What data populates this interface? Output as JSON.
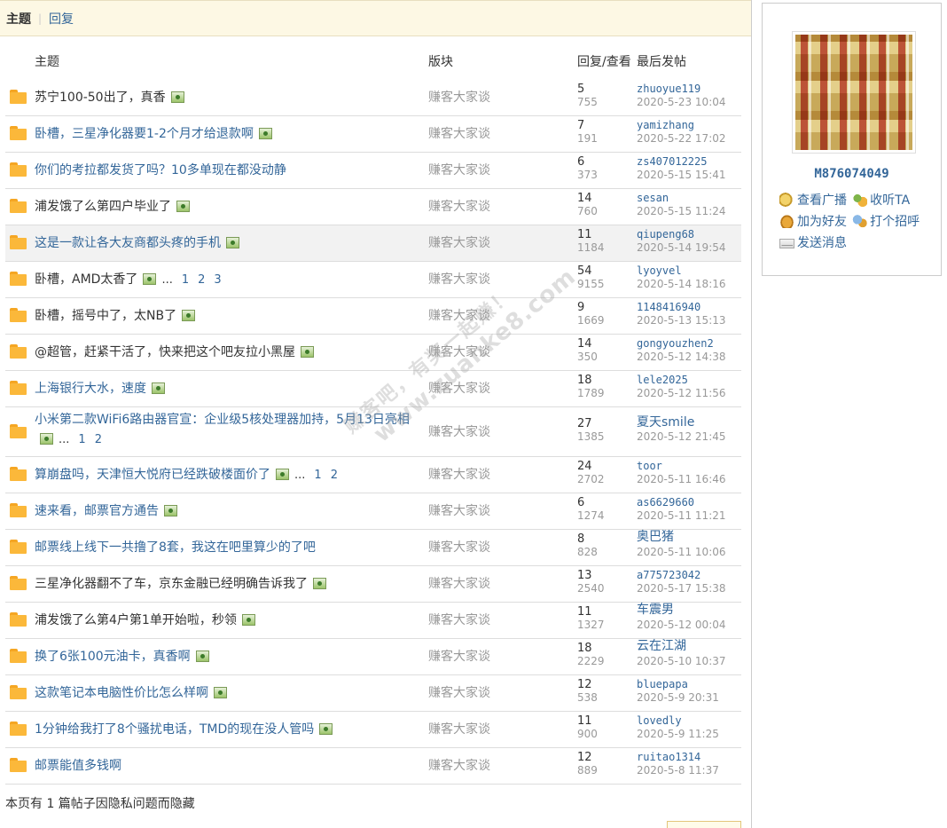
{
  "tabs": [
    {
      "label": "主题",
      "active": true
    },
    {
      "label": "回复",
      "active": false
    }
  ],
  "columns": {
    "topic": "主题",
    "forum": "版块",
    "replies_views": "回复/查看",
    "last_post": "最后发帖"
  },
  "threads": [
    {
      "title": "苏宁100-50出了，真香",
      "blue": false,
      "img": true,
      "pages": [],
      "forum": "赚客大家谈",
      "replies": "5",
      "views": "755",
      "author": "zhuoyue119",
      "date": "2020-5-23 10:04"
    },
    {
      "title": "卧槽，三星净化器要1-2个月才给退款啊",
      "blue": true,
      "img": true,
      "pages": [],
      "forum": "赚客大家谈",
      "replies": "7",
      "views": "191",
      "author": "yamizhang",
      "date": "2020-5-22 17:02"
    },
    {
      "title": "你们的考拉都发货了吗？10多单现在都没动静",
      "blue": true,
      "img": false,
      "pages": [],
      "forum": "赚客大家谈",
      "replies": "6",
      "views": "373",
      "author": "zs407012225",
      "date": "2020-5-15 15:41"
    },
    {
      "title": "浦发饿了么第四户毕业了",
      "blue": false,
      "img": true,
      "pages": [],
      "forum": "赚客大家谈",
      "replies": "14",
      "views": "760",
      "author": "sesan",
      "date": "2020-5-15 11:24"
    },
    {
      "title": "这是一款让各大友商都头疼的手机",
      "blue": true,
      "img": true,
      "pages": [],
      "forum": "赚客大家谈",
      "replies": "11",
      "views": "1184",
      "author": "qiupeng68",
      "date": "2020-5-14 19:54",
      "highlight": true
    },
    {
      "title": "卧槽，AMD太香了",
      "blue": false,
      "img": true,
      "ellipsis": "...",
      "pages": [
        "1",
        "2",
        "3"
      ],
      "forum": "赚客大家谈",
      "replies": "54",
      "views": "9155",
      "author": "lyoyvel",
      "date": "2020-5-14 18:16"
    },
    {
      "title": "卧槽，摇号中了，太NB了",
      "blue": false,
      "img": true,
      "pages": [],
      "forum": "赚客大家谈",
      "replies": "9",
      "views": "1669",
      "author": "1148416940",
      "date": "2020-5-13 15:13"
    },
    {
      "title": "@超管，赶紧干活了，快来把这个吧友拉小黑屋",
      "blue": false,
      "img": true,
      "pages": [],
      "forum": "赚客大家谈",
      "replies": "14",
      "views": "350",
      "author": "gongyouzhen2",
      "date": "2020-5-12 14:38"
    },
    {
      "title": "上海银行大水，速度",
      "blue": true,
      "img": true,
      "pages": [],
      "forum": "赚客大家谈",
      "replies": "18",
      "views": "1789",
      "author": "lele2025",
      "date": "2020-5-12 11:56"
    },
    {
      "title": "小米第二款WiFi6路由器官宣：企业级5核处理器加持，5月13日亮相",
      "blue": true,
      "img": true,
      "ellipsis": "...",
      "pages": [
        "1",
        "2"
      ],
      "forum": "赚客大家谈",
      "replies": "27",
      "views": "1385",
      "author": "夏天smile",
      "date": "2020-5-12 21:45",
      "tall": true
    },
    {
      "title": "算崩盘吗，天津恒大悦府已经跌破楼面价了",
      "blue": true,
      "img": true,
      "ellipsis": "...",
      "pages": [
        "1",
        "2"
      ],
      "forum": "赚客大家谈",
      "replies": "24",
      "views": "2702",
      "author": "toor",
      "date": "2020-5-11 16:46"
    },
    {
      "title": "速来看，邮票官方通告",
      "blue": true,
      "img": true,
      "pages": [],
      "forum": "赚客大家谈",
      "replies": "6",
      "views": "1274",
      "author": "as6629660",
      "date": "2020-5-11 11:21"
    },
    {
      "title": "邮票线上线下一共撸了8套，我这在吧里算少的了吧",
      "blue": true,
      "img": false,
      "pages": [],
      "forum": "赚客大家谈",
      "replies": "8",
      "views": "828",
      "author": "奥巴猪",
      "date": "2020-5-11 10:06"
    },
    {
      "title": "三星净化器翻不了车，京东金融已经明确告诉我了",
      "blue": false,
      "img": true,
      "pages": [],
      "forum": "赚客大家谈",
      "replies": "13",
      "views": "2540",
      "author": "a775723042",
      "date": "2020-5-17 15:38"
    },
    {
      "title": "浦发饿了么第4户第1单开始啦，秒领",
      "blue": false,
      "img": true,
      "pages": [],
      "forum": "赚客大家谈",
      "replies": "11",
      "views": "1327",
      "author": "车震男",
      "date": "2020-5-12 00:04"
    },
    {
      "title": "换了6张100元油卡，真香啊",
      "blue": true,
      "img": true,
      "pages": [],
      "forum": "赚客大家谈",
      "replies": "18",
      "views": "2229",
      "author": "云在江湖",
      "date": "2020-5-10 10:37"
    },
    {
      "title": "这款笔记本电脑性价比怎么样啊",
      "blue": true,
      "img": true,
      "pages": [],
      "forum": "赚客大家谈",
      "replies": "12",
      "views": "538",
      "author": "bluepapa",
      "date": "2020-5-9 20:31"
    },
    {
      "title": "1分钟给我打了8个骚扰电话，TMD的现在没人管吗",
      "blue": true,
      "img": true,
      "pages": [],
      "forum": "赚客大家谈",
      "replies": "11",
      "views": "900",
      "author": "lovedly",
      "date": "2020-5-9 11:25"
    },
    {
      "title": "邮票能值多钱啊",
      "blue": true,
      "img": false,
      "pages": [],
      "forum": "赚客大家谈",
      "replies": "12",
      "views": "889",
      "author": "ruitao1314",
      "date": "2020-5-8 11:37"
    }
  ],
  "hidden_note": "本页有 1 篇帖子因隐私问题而隐藏",
  "profile": {
    "username": "M876074049",
    "actions": [
      {
        "label": "查看广播",
        "icon": "broadcast-icon"
      },
      {
        "label": "收听TA",
        "icon": "follow-icon"
      },
      {
        "label": "加为好友",
        "icon": "add-friend-icon"
      },
      {
        "label": "打个招呼",
        "icon": "greet-icon"
      },
      {
        "label": "发送消息",
        "icon": "message-icon"
      }
    ]
  },
  "watermark": {
    "line1": "赚客吧，有奖一起赚！",
    "line2": "www.zuanke8.com"
  },
  "colors": {
    "link": "#336699",
    "muted": "#999999",
    "tabbar_bg": "#fdf8e4",
    "folder": "#fbb83a"
  }
}
